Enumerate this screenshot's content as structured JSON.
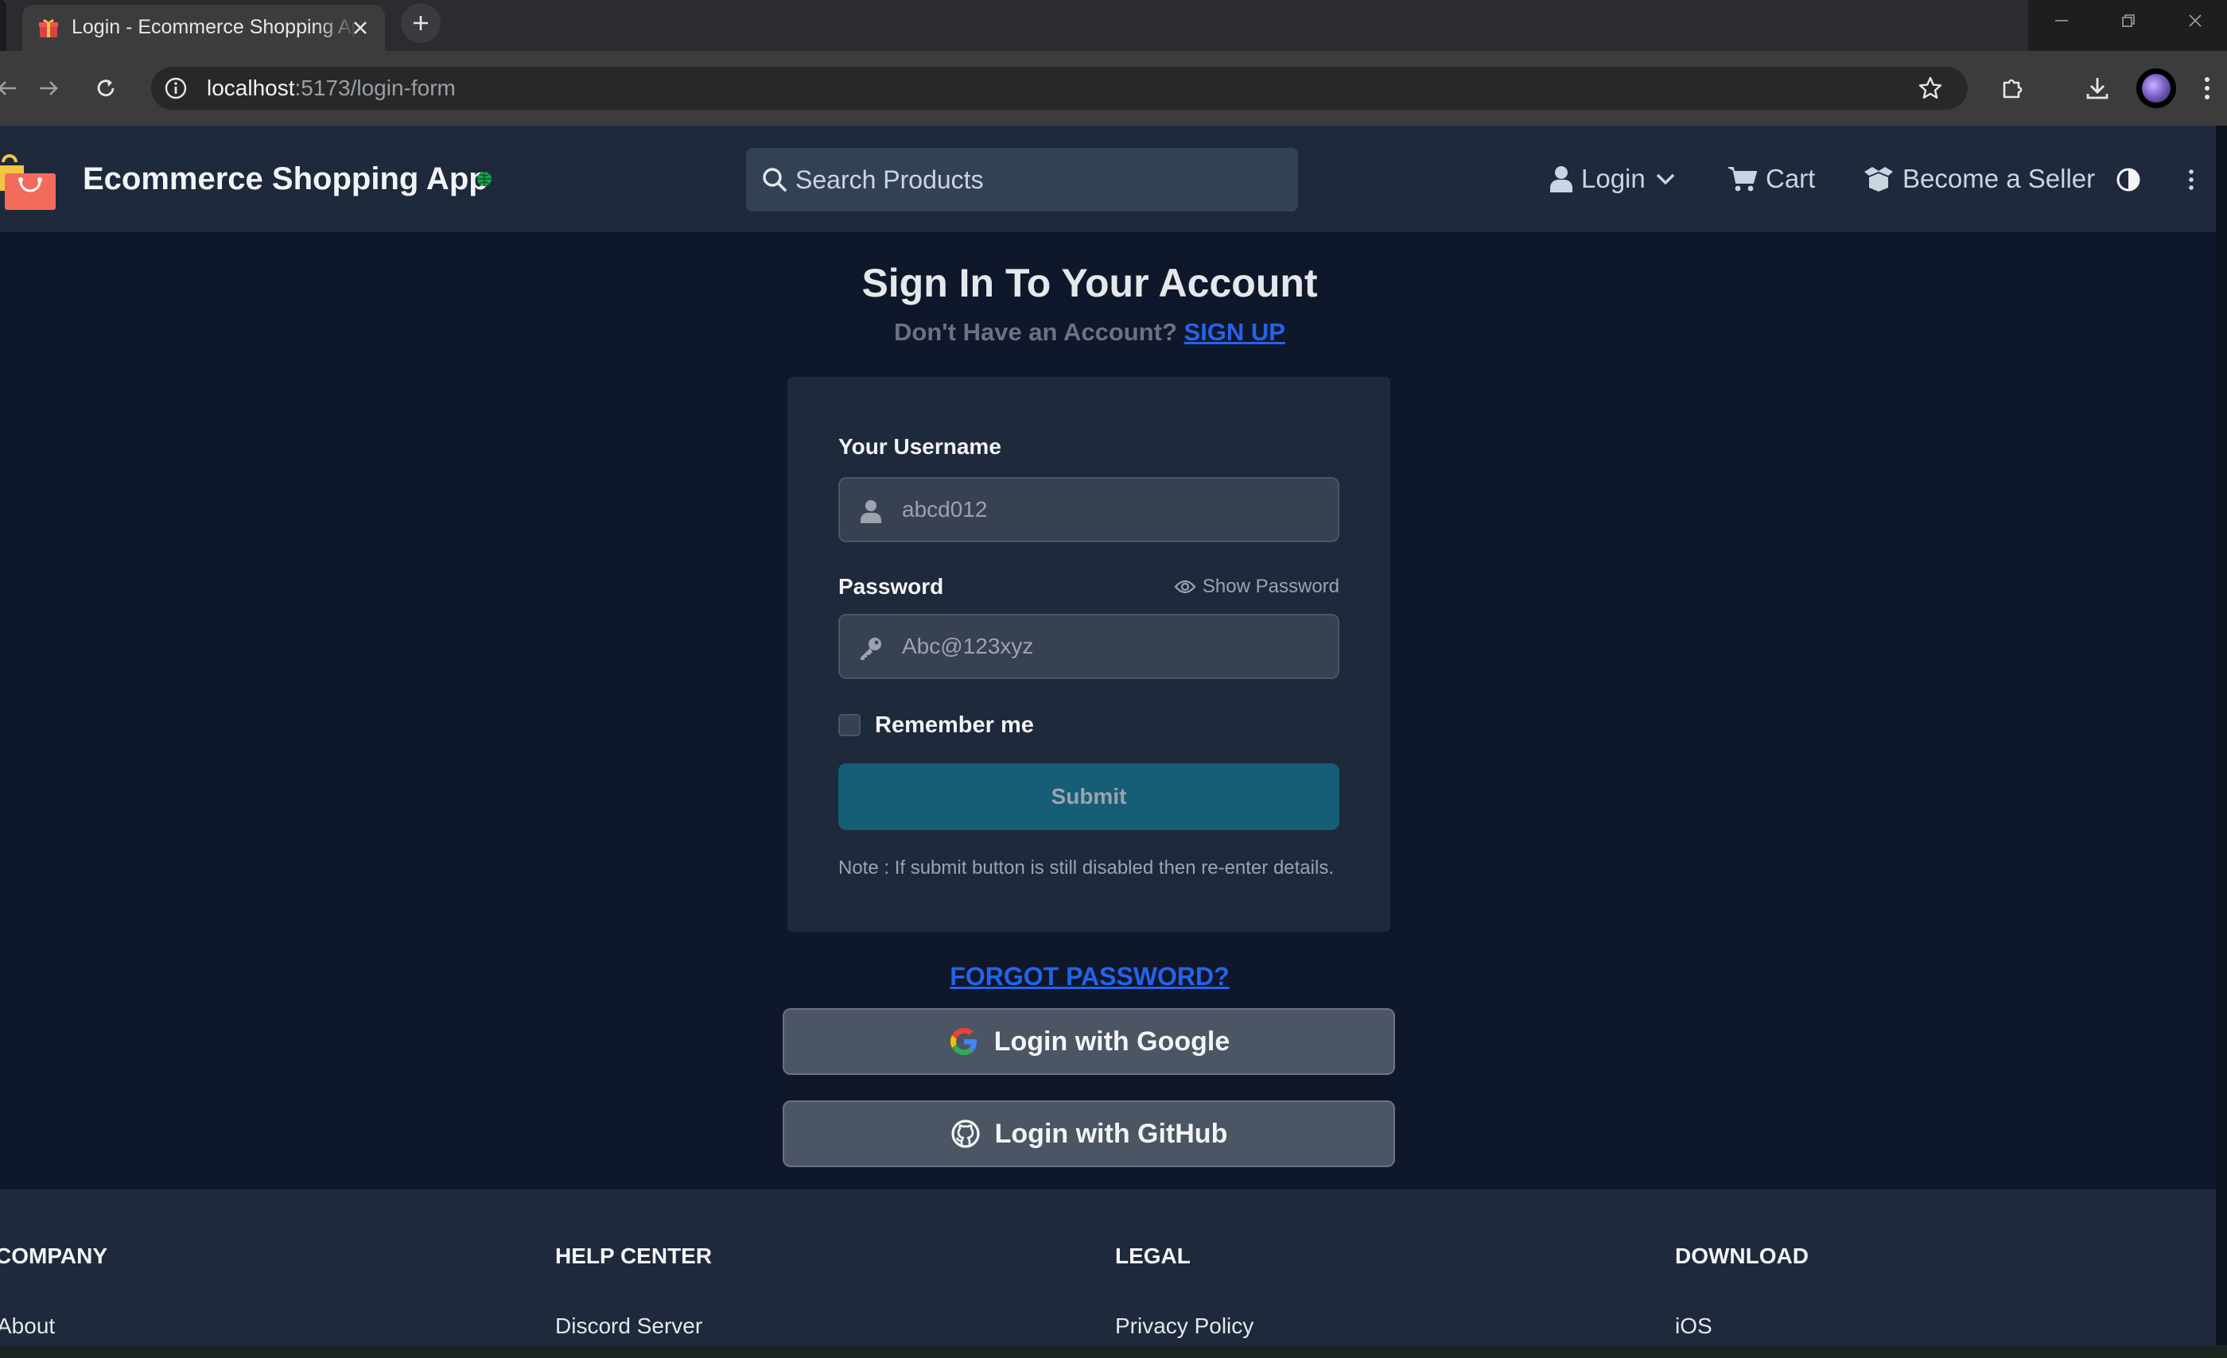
{
  "browser": {
    "tab_title": "Login - Ecommerce Shopping App",
    "url_host": "localhost",
    "url_rest": ":5173/login-form"
  },
  "header": {
    "brand": "Ecommerce Shopping App",
    "search_placeholder": "Search Products",
    "nav": {
      "login": "Login",
      "cart": "Cart",
      "seller": "Become a Seller"
    }
  },
  "login": {
    "title": "Sign In To Your Account",
    "no_account_text": "Don't Have an Account?",
    "signup_link": "SIGN UP",
    "username_label": "Your Username",
    "username_placeholder": "abcd012",
    "password_label": "Password",
    "show_password": "Show Password",
    "password_placeholder": "Abc@123xyz",
    "remember_me": "Remember me",
    "submit": "Submit",
    "note": "Note : If submit button is still disabled then re-enter details.",
    "forgot": "FORGOT PASSWORD?",
    "google": "Login with Google",
    "github": "Login with GitHub"
  },
  "footer": {
    "columns": [
      {
        "title": "COMPANY",
        "first_link": "About"
      },
      {
        "title": "HELP CENTER",
        "first_link": "Discord Server"
      },
      {
        "title": "LEGAL",
        "first_link": "Privacy Policy"
      },
      {
        "title": "DOWNLOAD",
        "first_link": "iOS"
      }
    ]
  },
  "colors": {
    "page_bg": "#0f172a",
    "header_bg": "#1e293b",
    "accent_link": "#2563eb",
    "submit_bg": "#155e75"
  }
}
